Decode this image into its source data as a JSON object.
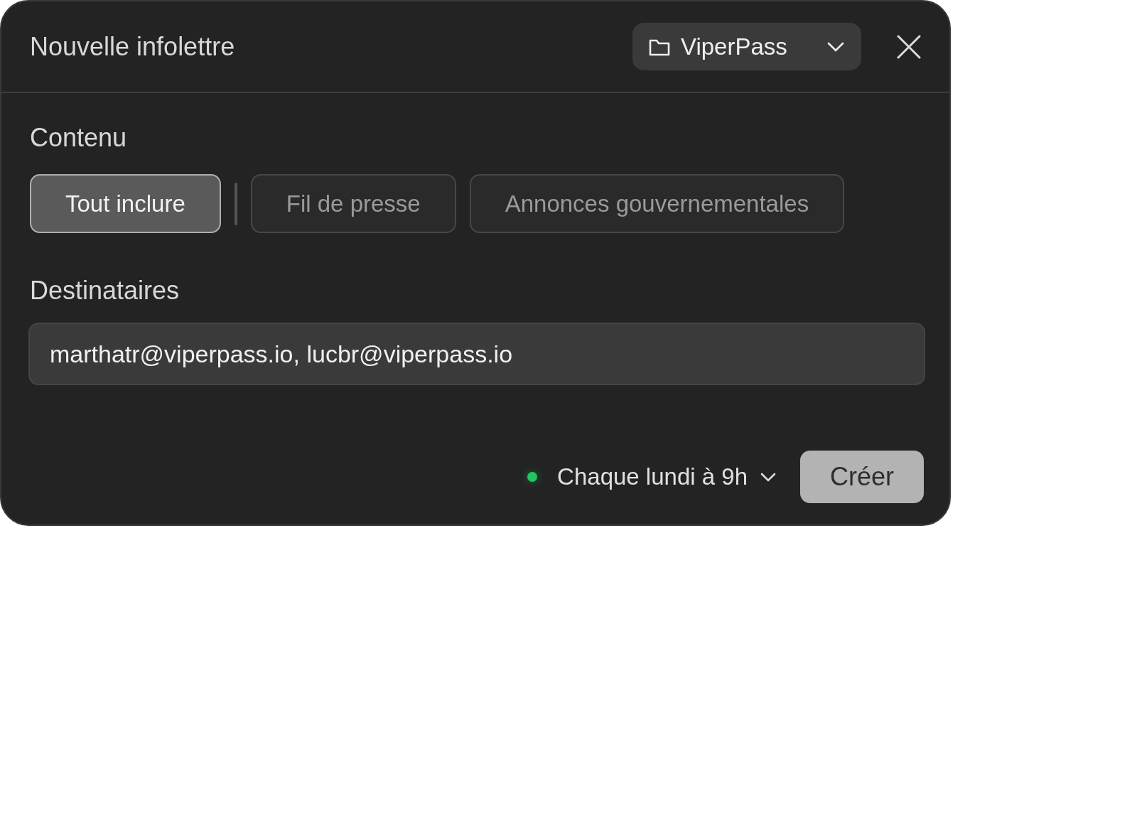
{
  "dialog": {
    "title": "Nouvelle infolettre",
    "folder": {
      "label": "ViperPass"
    }
  },
  "content": {
    "label": "Contenu",
    "tabs": [
      {
        "label": "Tout inclure",
        "selected": true
      },
      {
        "label": "Fil de presse",
        "selected": false
      },
      {
        "label": "Annonces gouvernementales",
        "selected": false
      }
    ]
  },
  "recipients": {
    "label": "Destinataires",
    "value": "marthatr@viperpass.io, lucbr@viperpass.io"
  },
  "footer": {
    "schedule": {
      "label": "Chaque lundi à 9h",
      "active": true
    },
    "submit": "Créer"
  }
}
